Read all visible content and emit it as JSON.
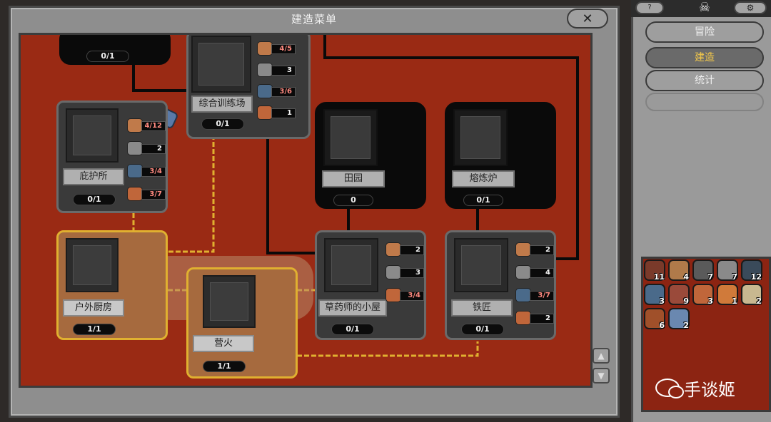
{
  "window": {
    "title": "建造菜单"
  },
  "board": {
    "cards": [
      {
        "name": "top-left-building",
        "label": "",
        "count": "0/1",
        "resources": []
      },
      {
        "name": "training-ground",
        "label": "综合训练场",
        "count": "0/1",
        "resources": [
          {
            "type": "wood",
            "qty": "4/5",
            "short": false
          },
          {
            "type": "stone",
            "qty": "3",
            "short": false
          },
          {
            "type": "metal",
            "qty": "3/6",
            "short": true
          },
          {
            "type": "orb",
            "qty": "1",
            "short": false
          }
        ]
      },
      {
        "name": "shelter",
        "label": "庇护所",
        "count": "0/1",
        "resources": [
          {
            "type": "wood",
            "qty": "4/12",
            "short": true
          },
          {
            "type": "stone",
            "qty": "2",
            "short": false
          },
          {
            "type": "metal",
            "qty": "3/4",
            "short": true
          },
          {
            "type": "orb",
            "qty": "3/7",
            "short": true
          }
        ]
      },
      {
        "name": "farm",
        "label": "田园",
        "count": "0",
        "resources": []
      },
      {
        "name": "smelter",
        "label": "熔炼炉",
        "count": "0/1",
        "resources": []
      },
      {
        "name": "outdoor-kitchen",
        "label": "户外厨房",
        "count": "1/1",
        "resources": []
      },
      {
        "name": "campfire",
        "label": "营火",
        "count": "1/1",
        "resources": []
      },
      {
        "name": "herbalist-hut",
        "label": "草药师的小屋",
        "count": "0/1",
        "resources": [
          {
            "type": "wood",
            "qty": "2",
            "short": false
          },
          {
            "type": "stone",
            "qty": "3",
            "short": false
          },
          {
            "type": "orb",
            "qty": "3/4",
            "short": true
          }
        ]
      },
      {
        "name": "blacksmith",
        "label": "铁匠",
        "count": "0/1",
        "resources": [
          {
            "type": "wood",
            "qty": "2",
            "short": false
          },
          {
            "type": "stone",
            "qty": "4",
            "short": false
          },
          {
            "type": "metal",
            "qty": "3/7",
            "short": true
          },
          {
            "type": "orb",
            "qty": "2",
            "short": false
          }
        ]
      }
    ]
  },
  "sidebar": {
    "help_label": "?",
    "tabs": [
      {
        "label": "冒险",
        "active": false
      },
      {
        "label": "建造",
        "active": true
      },
      {
        "label": "统计",
        "active": false
      }
    ]
  },
  "inventory": {
    "items": [
      {
        "icon": "branch-icon",
        "count": "11",
        "color": "#7a3a2a"
      },
      {
        "icon": "plank-icon",
        "count": "4",
        "color": "#b07a4a"
      },
      {
        "icon": "rock-icon",
        "count": "7",
        "color": "#5a5a5a"
      },
      {
        "icon": "stone-block-icon",
        "count": "7",
        "color": "#8a8a8a"
      },
      {
        "icon": "ore-icon",
        "count": "12",
        "color": "#3a4a5a"
      },
      {
        "icon": "metal-icon",
        "count": "3",
        "color": "#4a6a8a"
      },
      {
        "icon": "meat-icon",
        "count": "9",
        "color": "#9a4a3a"
      },
      {
        "icon": "mushroom-icon",
        "count": "3",
        "color": "#c0663a"
      },
      {
        "icon": "orb-icon",
        "count": "1",
        "color": "#d07a3a"
      },
      {
        "icon": "book-icon",
        "count": "2",
        "color": "#c8b890"
      },
      {
        "icon": "food-icon",
        "count": "6",
        "color": "#a0502a"
      },
      {
        "icon": "crystal-icon",
        "count": "2",
        "color": "#6a88b0"
      }
    ]
  },
  "watermark": {
    "text": "手谈姬"
  }
}
